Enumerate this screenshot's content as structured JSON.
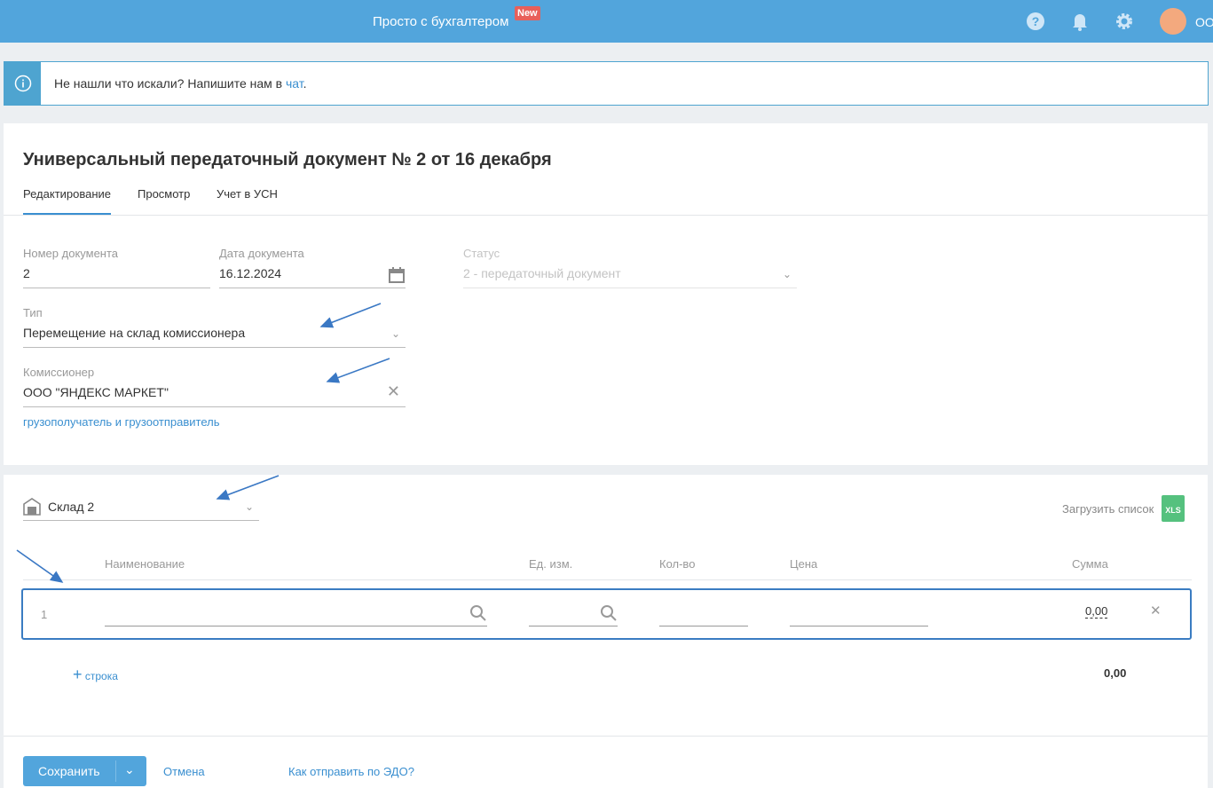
{
  "header": {
    "brand": "Просто с бухгалтером",
    "badge": "New",
    "user": "ОО"
  },
  "info": {
    "text": "Не нашли что искали? Напишите нам в ",
    "link": "чат",
    "end": "."
  },
  "doc": {
    "title": "Универсальный передаточный документ № 2 от 16 декабря",
    "tabs": [
      "Редактирование",
      "Просмотр",
      "Учет в УСН"
    ],
    "number_label": "Номер документа",
    "number": "2",
    "date_label": "Дата документа",
    "date": "16.12.2024",
    "status_label": "Статус",
    "status": "2 - передаточный документ",
    "type_label": "Тип",
    "type": "Перемещение на склад комиссионера",
    "agent_label": "Комиссионер",
    "agent": "ООО \"ЯНДЕКС МАРКЕТ\"",
    "consignee_link": "грузополучатель и грузоотправитель"
  },
  "items": {
    "warehouse": "Склад 2",
    "upload": "Загрузить список",
    "xls": "XLS",
    "columns": [
      "Наименование",
      "Ед. изм.",
      "Кол-во",
      "Цена",
      "Сумма"
    ],
    "rows": [
      {
        "n": "1",
        "sum": "0,00"
      }
    ],
    "add_row": "строка",
    "total": "0,00"
  },
  "footer": {
    "save": "Сохранить",
    "cancel": "Отмена",
    "edo": "Как отправить по ЭДО?"
  }
}
